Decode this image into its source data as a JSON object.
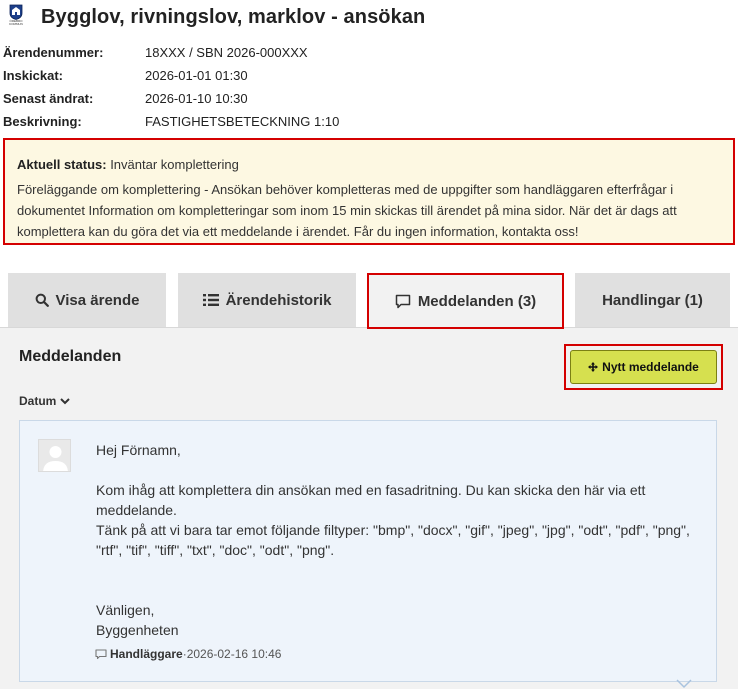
{
  "header": {
    "title": "Bygglov, rivningslov, marklov - ansökan",
    "logo_text_line1": "ÖREBRO",
    "logo_text_line2": "KOMMUN"
  },
  "meta": {
    "rows": [
      {
        "label": "Ärendenummer:",
        "value": "18XXX / SBN 2026-000XXX"
      },
      {
        "label": "Inskickat:",
        "value": "2026-01-01 01:30"
      },
      {
        "label": "Senast ändrat:",
        "value": "2026-01-10 10:30"
      },
      {
        "label": "Beskrivning:",
        "value": "FASTIGHETSBETECKNING 1:10"
      }
    ]
  },
  "status": {
    "label": "Aktuell status:",
    "value": " Inväntar komplettering",
    "text": "Föreläggande om komplettering - Ansökan behöver kompletteras med de uppgifter som handläggaren efterfrågar i dokumentet Information om kompletteringar som inom 15 min skickas till ärendet på mina sidor. När det är dags att komplettera kan du göra det via ett meddelande i ärendet. Får du ingen information, kontakta oss!"
  },
  "tabs": [
    {
      "label": "Visa ärende",
      "icon": "search-icon"
    },
    {
      "label": "Ärendehistorik",
      "icon": "list-icon"
    },
    {
      "label": "Meddelanden (3)",
      "icon": "speech-bubble-icon"
    },
    {
      "label": "Handlingar (1)",
      "icon": ""
    }
  ],
  "messages_section": {
    "title": "Meddelanden",
    "new_button": "Nytt meddelande",
    "sort_label": "Datum"
  },
  "message": {
    "body": "Hej Förnamn,\n\nKom ihåg att komplettera din ansökan med en fasadritning. Du kan skicka den här via ett meddelande.\nTänk på att vi bara tar emot följande filtyper: \"bmp\", \"docx\", \"gif\", \"jpeg\", \"jpg\", \"odt\", \"pdf\", \"png\", \"rtf\", \"tif\", \"tiff\", \"txt\", \"doc\", \"odt\", \"png\".\n\n\nVänligen,\nByggenheten",
    "sender": "Handläggare",
    "separator": " · ",
    "timestamp": "2026-02-16 10:46"
  },
  "colors": {
    "alert_border": "#d40000",
    "status_bg": "#fdf8e2",
    "button_bg": "#d6e04f",
    "card_bg": "#eef4fb"
  }
}
